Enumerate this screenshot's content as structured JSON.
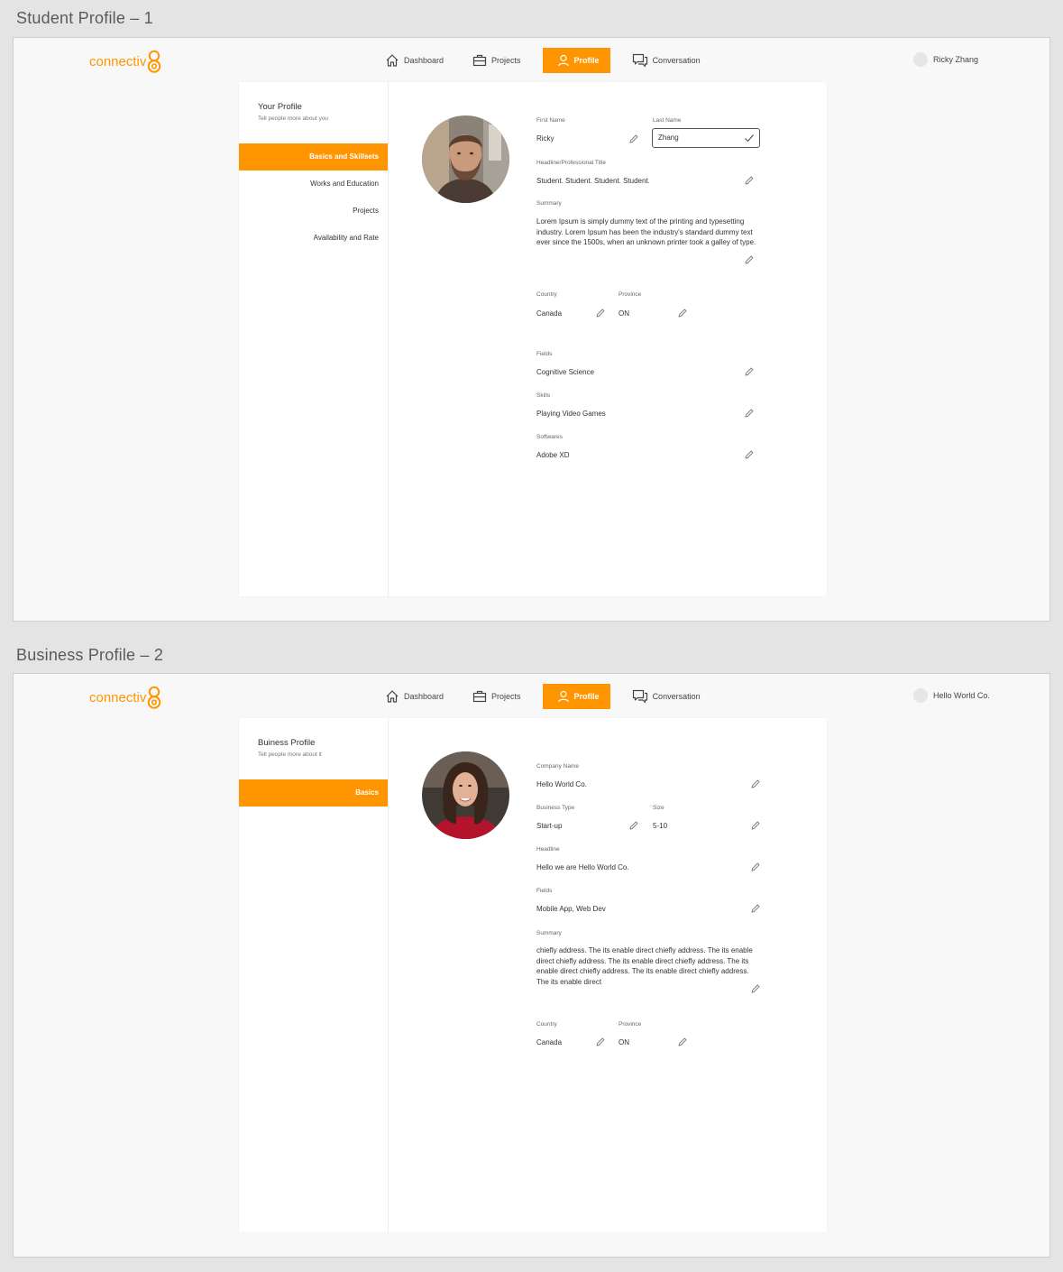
{
  "boards": [
    {
      "title": "Student Profile – 1",
      "logo": "connectiv",
      "nav": [
        {
          "label": "Dashboard",
          "icon": "home-icon"
        },
        {
          "label": "Projects",
          "icon": "briefcase-icon"
        },
        {
          "label": "Profile",
          "icon": "user-icon",
          "active": true
        },
        {
          "label": "Conversation",
          "icon": "chat-icon"
        }
      ],
      "user_name": "Ricky Zhang",
      "sidebar": {
        "title": "Your Profile",
        "subtitle": "Tell people more about you",
        "items": [
          "Basics and Skillsets",
          "Works and Education",
          "Projects",
          "Availability and Rate"
        ]
      },
      "fields": {
        "first_name_label": "First Name",
        "first_name": "Ricky",
        "last_name_label": "Last Name",
        "last_name": "Zhang",
        "headline_label": "Headline/Professional Title",
        "headline": "Student. Student. Student. Student.",
        "summary_label": "Summary",
        "summary": "Lorem Ipsum is simply dummy text of the printing and typesetting industry. Lorem Ipsum has been the industry's standard dummy text ever since the 1500s, when an unknown printer took a galley of type.",
        "country_label": "Country",
        "country": "Canada",
        "province_label": "Province",
        "province": "ON",
        "fields_label": "Fields",
        "fields_value": "Cognitive Science",
        "skills_label": "Skills",
        "skills": "Playing Video Games",
        "softwares_label": "Softwares",
        "softwares": "Adobe XD"
      }
    },
    {
      "title": "Business Profile – 2",
      "logo": "connectiv",
      "nav": [
        {
          "label": "Dashboard",
          "icon": "home-icon"
        },
        {
          "label": "Projects",
          "icon": "briefcase-icon"
        },
        {
          "label": "Profile",
          "icon": "user-icon",
          "active": true
        },
        {
          "label": "Conversation",
          "icon": "chat-icon"
        }
      ],
      "user_name": "Hello World Co.",
      "sidebar": {
        "title": "Buiness Profile",
        "subtitle": "Tell people more about it",
        "items": [
          "Basics"
        ]
      },
      "fields": {
        "company_label": "Company Name",
        "company": "Hello World Co.",
        "type_label": "Business Type",
        "type": "Start-up",
        "size_label": "Size",
        "size": "5-10",
        "headline_label": "Headline",
        "headline": "Hello we are Hello World Co.",
        "fields_label": "Fields",
        "fields_value": "Mobile App, Web Dev",
        "summary_label": "Summary",
        "summary": "chiefly address. The its enable direct chiefly address. The its enable direct chiefly address. The its enable direct chiefly address. The its enable direct chiefly address. The its enable direct chiefly address. The its enable direct",
        "country_label": "Country",
        "country": "Canada",
        "province_label": "Province",
        "province": "ON"
      }
    }
  ],
  "colors": {
    "accent": "#ff9500",
    "background": "#f8f8f8",
    "card": "#ffffff"
  }
}
